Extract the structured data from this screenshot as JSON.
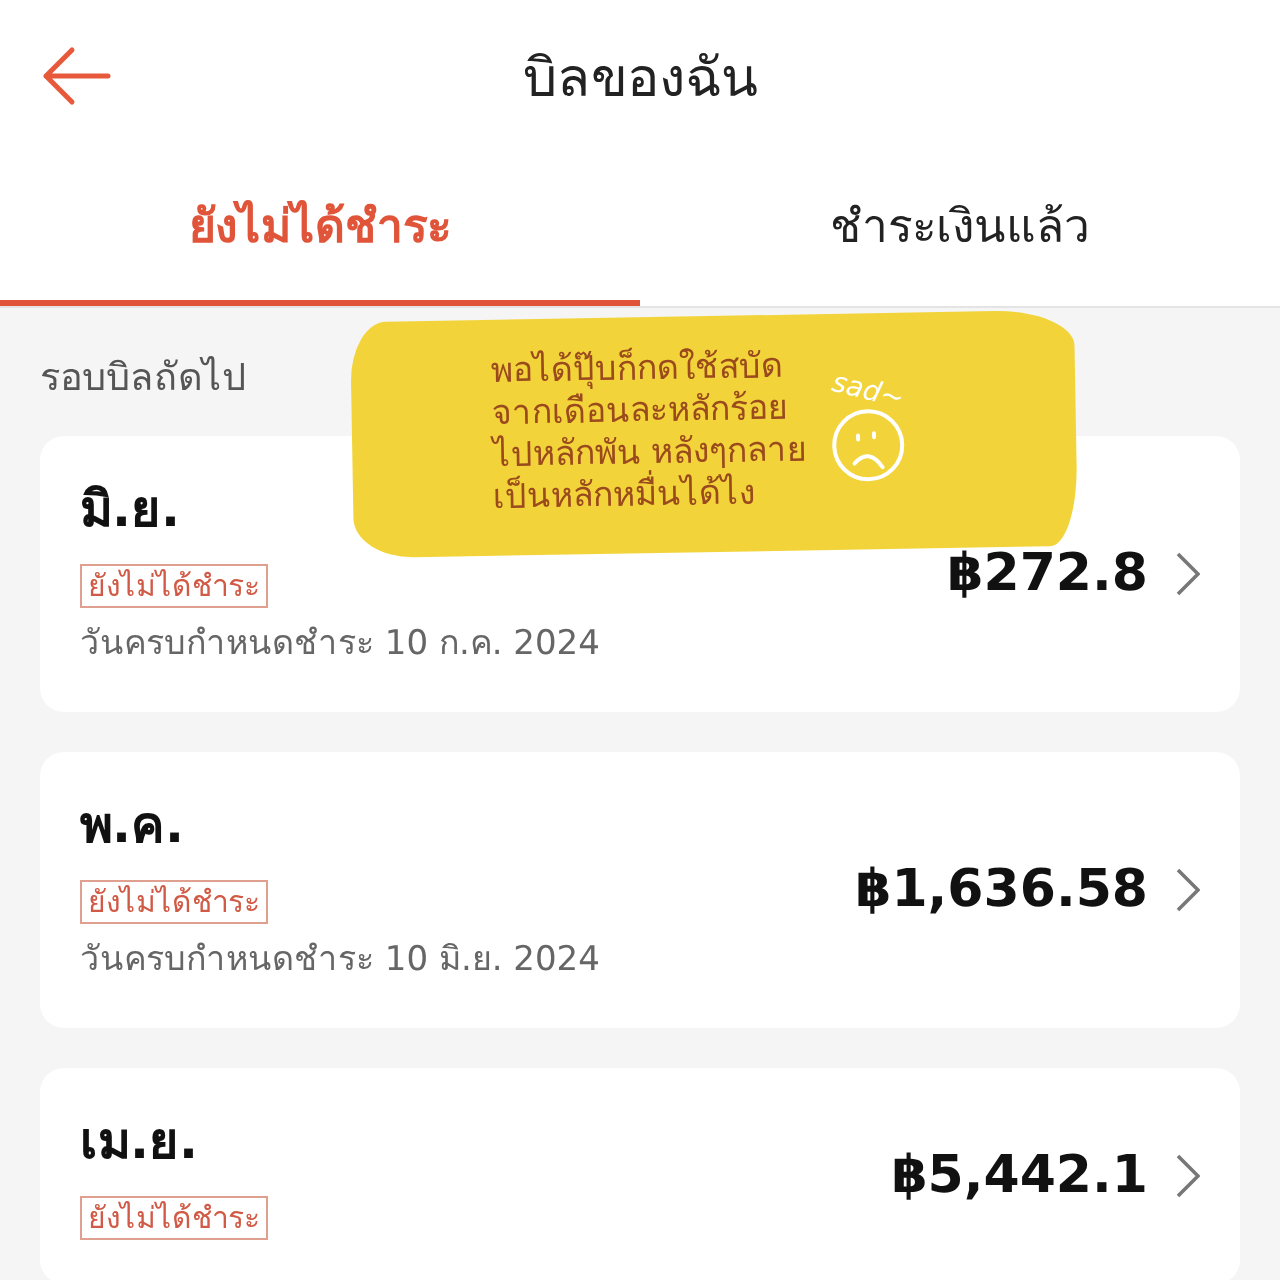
{
  "header": {
    "title": "บิลของฉัน"
  },
  "tabs": [
    {
      "label": "ยังไม่ได้ชำระ",
      "selected": true
    },
    {
      "label": "ชำระเงินแล้ว",
      "selected": false
    }
  ],
  "section_label": "รอบบิลถัดไป",
  "bills": [
    {
      "month": "มิ.ย.",
      "status": "ยังไม่ได้ชำระ",
      "due": "วันครบกำหนดชำระ 10 ก.ค. 2024",
      "amount": "฿272.8"
    },
    {
      "month": "พ.ค.",
      "status": "ยังไม่ได้ชำระ",
      "due": "วันครบกำหนดชำระ 10 มิ.ย. 2024",
      "amount": "฿1,636.58"
    },
    {
      "month": "เม.ย.",
      "status": "ยังไม่ได้ชำระ",
      "amount": "฿5,442.1"
    }
  ],
  "sticker": {
    "lines": [
      "พอได้ปุ๊บก็กดใช้สบัด",
      "จากเดือนละหลักร้อย",
      "ไปหลักพัน หลังๆกลาย",
      "เป็นหลักหมื่นได้ไง"
    ],
    "face_caption": "sad~"
  }
}
